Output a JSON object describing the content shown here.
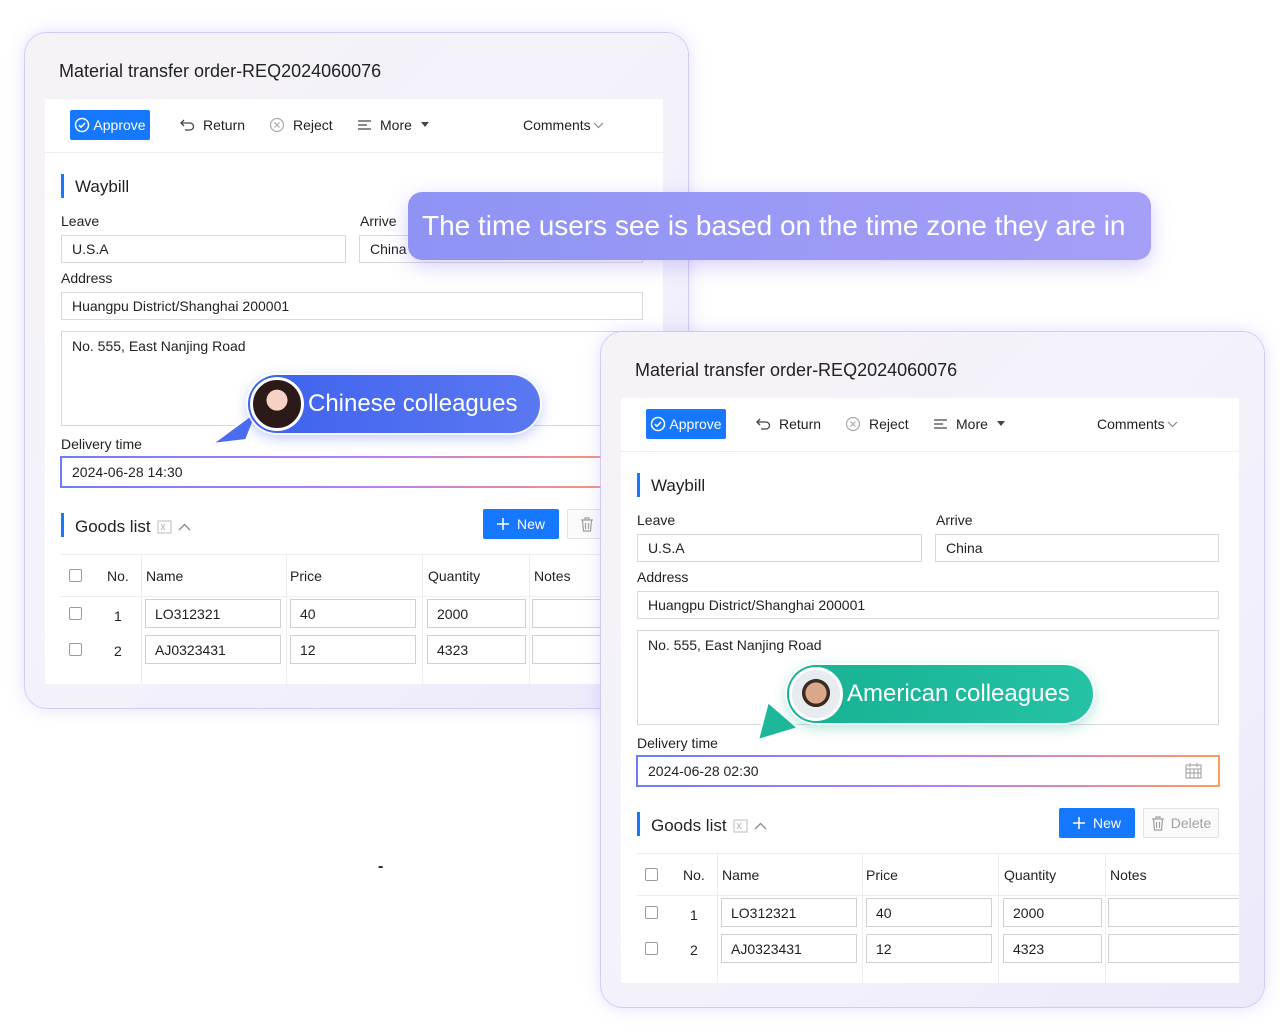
{
  "banner": "The time users see is based on the time zone they are in",
  "stray_mark": "-",
  "colors": {
    "primary": "#1677ff",
    "banner": "#9b98f6",
    "chinese_bubble": "#4a6cf0",
    "american_bubble": "#1db89a"
  },
  "chinese_view": {
    "title": "Material transfer order-REQ2024060076",
    "toolbar": {
      "approve": "Approve",
      "return": "Return",
      "reject": "Reject",
      "more": "More",
      "comments": "Comments"
    },
    "section": "Waybill",
    "leave_label": "Leave",
    "leave_value": "U.S.A",
    "arrive_label": "Arrive",
    "arrive_value": "China",
    "address_label": "Address",
    "address_value": "Huangpu District/Shanghai 200001",
    "street_value": "No. 555, East Nanjing Road",
    "delivery_label": "Delivery time",
    "delivery_value": "2024-06-28 14:30",
    "bubble": "Chinese colleagues",
    "goods_title": "Goods list",
    "new_button": "New",
    "columns": {
      "no": "No.",
      "name": "Name",
      "price": "Price",
      "quantity": "Quantity",
      "notes": "Notes"
    },
    "rows": [
      {
        "no": "1",
        "name": "LO312321",
        "price": "40",
        "quantity": "2000",
        "notes": ""
      },
      {
        "no": "2",
        "name": "AJ0323431",
        "price": "12",
        "quantity": "4323",
        "notes": ""
      }
    ]
  },
  "american_view": {
    "title": "Material transfer order-REQ2024060076",
    "toolbar": {
      "approve": "Approve",
      "return": "Return",
      "reject": "Reject",
      "more": "More",
      "comments": "Comments"
    },
    "section": "Waybill",
    "leave_label": "Leave",
    "leave_value": "U.S.A",
    "arrive_label": "Arrive",
    "arrive_value": "China",
    "address_label": "Address",
    "address_value": "Huangpu District/Shanghai 200001",
    "street_value": "No. 555, East Nanjing Road",
    "delivery_label": "Delivery time",
    "delivery_value": "2024-06-28 02:30",
    "bubble": "American colleagues",
    "goods_title": "Goods list",
    "new_button": "New",
    "delete_button": "Delete",
    "columns": {
      "no": "No.",
      "name": "Name",
      "price": "Price",
      "quantity": "Quantity",
      "notes": "Notes"
    },
    "rows": [
      {
        "no": "1",
        "name": "LO312321",
        "price": "40",
        "quantity": "2000",
        "notes": ""
      },
      {
        "no": "2",
        "name": "AJ0323431",
        "price": "12",
        "quantity": "4323",
        "notes": ""
      }
    ]
  }
}
